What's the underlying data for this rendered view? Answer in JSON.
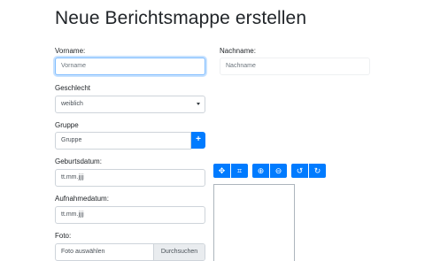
{
  "page": {
    "title": "Neue Berichtsmappe erstellen"
  },
  "form": {
    "vorname": {
      "label": "Vorname:",
      "placeholder": "Vorname"
    },
    "nachname": {
      "label": "Nachname:",
      "placeholder": "Nachname"
    },
    "geschlecht": {
      "label": "Geschlecht",
      "value": "weiblich"
    },
    "gruppe": {
      "label": "Gruppe",
      "value": "Gruppe",
      "button": "+"
    },
    "geburtsdatum": {
      "label": "Geburtsdatum:",
      "placeholder": "tt.mm.jjjj"
    },
    "aufnahmedatum": {
      "label": "Aufnahmedatum:",
      "placeholder": "tt.mm.jjjj"
    },
    "foto": {
      "label": "Foto:",
      "placeholder": "Foto auswählen",
      "button": "Durchsuchen"
    }
  },
  "toolbar": {
    "icons": [
      "move-icon",
      "crop-icon",
      "zoom-in-icon",
      "zoom-out-icon",
      "rotate-left-icon",
      "rotate-right-icon"
    ],
    "glyphs": {
      "move": "✥",
      "crop": "⌗",
      "zoom_in": "⊕",
      "zoom_out": "⊖",
      "rotate_left": "↺",
      "rotate_right": "↻"
    }
  },
  "colors": {
    "primary": "#007bff",
    "focus": "#80bdff",
    "border": "#ced4da"
  }
}
